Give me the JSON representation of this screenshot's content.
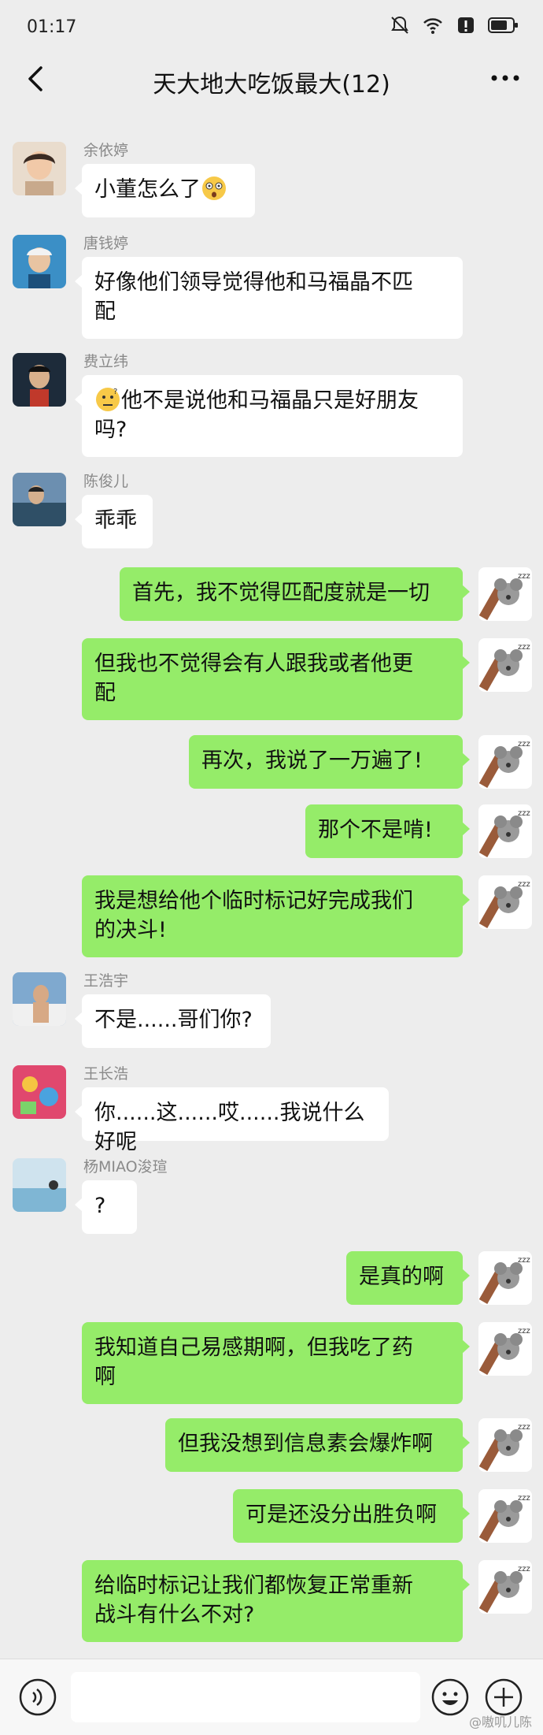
{
  "status_bar": {
    "time": "01:17",
    "icons": [
      "mute-icon",
      "wifi-icon",
      "alert-icon",
      "battery-icon"
    ]
  },
  "header": {
    "title": "天大地大吃饭最大(12)",
    "back_icon": "chevron-left-icon",
    "more_icon": "more-dots-icon"
  },
  "messages": [
    {
      "side": "left",
      "sender": "余依婷",
      "text": "小董怎么了",
      "trailing_emoji": "shocked-emoji"
    },
    {
      "side": "left",
      "sender": "唐钱婷",
      "line1": "好像他们领导觉得他和马福晶不匹",
      "line2": "配"
    },
    {
      "side": "left",
      "sender": "费立纬",
      "line1": "他不是说他和马福晶只是好朋友",
      "line2": "吗?",
      "leading_emoji": "thinking-emoji"
    },
    {
      "side": "left",
      "sender": "陈俊儿",
      "text": "乖乖"
    },
    {
      "side": "right",
      "text": "首先，我不觉得匹配度就是一切"
    },
    {
      "side": "right",
      "line1": "但我也不觉得会有人跟我或者他更",
      "line2": "配"
    },
    {
      "side": "right",
      "text": "再次，我说了一万遍了!"
    },
    {
      "side": "right",
      "text": "那个不是啃!"
    },
    {
      "side": "right",
      "line1": "我是想给他个临时标记好完成我们",
      "line2": "的决斗!"
    },
    {
      "side": "left",
      "sender": "王浩宇",
      "text": "不是......哥们你?"
    },
    {
      "side": "left",
      "sender": "王长浩",
      "text": "你......这......哎......我说什么好呢"
    },
    {
      "side": "left",
      "sender": "杨MIAO浚瑄",
      "text": "?"
    },
    {
      "side": "right",
      "text": "是真的啊"
    },
    {
      "side": "right",
      "line1": "我知道自己易感期啊，但我吃了药",
      "line2": "啊"
    },
    {
      "side": "right",
      "text": "但我没想到信息素会爆炸啊"
    },
    {
      "side": "right",
      "text": "可是还没分出胜负啊"
    },
    {
      "side": "right",
      "line1": "给临时标记让我们都恢复正常重新",
      "line2": "战斗有什么不对?"
    }
  ],
  "input_bar": {
    "voice_icon": "voice-icon",
    "emoji_icon": "emoji-icon",
    "plus_icon": "plus-icon",
    "placeholder": ""
  },
  "watermark_corner": "@嗷叽儿陈",
  "colors": {
    "background": "#ededed",
    "my_bubble": "#95ec69",
    "other_bubble": "#ffffff"
  }
}
